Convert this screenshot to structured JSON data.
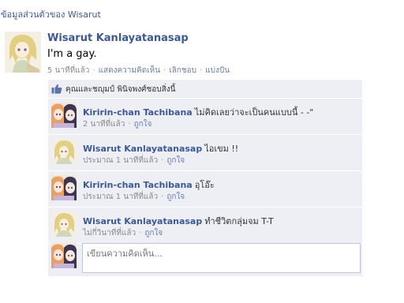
{
  "page": {
    "title": "ข้อมูลส่วนตัวของ Wisarut"
  },
  "post": {
    "author": "Wisarut Kanlayatanasap",
    "message": "I'm a gay.",
    "timestamp": "5 นาทีที่แล้ว",
    "actions": [
      "แสดงความคิดเห็น",
      "เลิกชอบ",
      "แบ่งปัน"
    ],
    "avatar_icon": "anime-avatar-blonde-icon"
  },
  "likes": {
    "text": "คุณและชญุมป์ พินิจพงศ์ชอบสิ่งนี้",
    "icon": "thumbs-up-icon"
  },
  "comments": [
    {
      "author": "Kiririn-chan Tachibana",
      "text": "ไม่คิดเลยว่าจะเป็นคนแบบนี้ - -\"",
      "time": "2 นาทีที่แล้ว",
      "like_label": "ถูกใจ",
      "avatar_icon": "anime-avatar-duo-icon"
    },
    {
      "author": "Wisarut Kanlayatanasap",
      "text": "ไอเขม !!",
      "time": "ประมาณ 1 นาทีที่แล้ว",
      "like_label": "ถูกใจ",
      "avatar_icon": "anime-avatar-blonde-icon"
    },
    {
      "author": "Kiririn-chan Tachibana",
      "text": "อุโอ๊ะ",
      "time": "ประมาณ 1 นาทีที่แล้ว",
      "like_label": "ถูกใจ",
      "avatar_icon": "anime-avatar-duo-icon"
    },
    {
      "author": "Wisarut Kanlayatanasap",
      "text": "ทำชีวิตกลุ่มจม T-T",
      "time": "ไม่กี่วินาทีที่แล้ว",
      "like_label": "ถูกใจ",
      "avatar_icon": "anime-avatar-blonde-icon"
    }
  ],
  "composer": {
    "placeholder": "เขียนความคิดเห็น...",
    "value": "",
    "avatar_icon": "anime-avatar-duo-icon"
  },
  "colors": {
    "link": "#3b5998",
    "feedback_bg": "#edeff4",
    "meta": "#8a8a8a"
  }
}
